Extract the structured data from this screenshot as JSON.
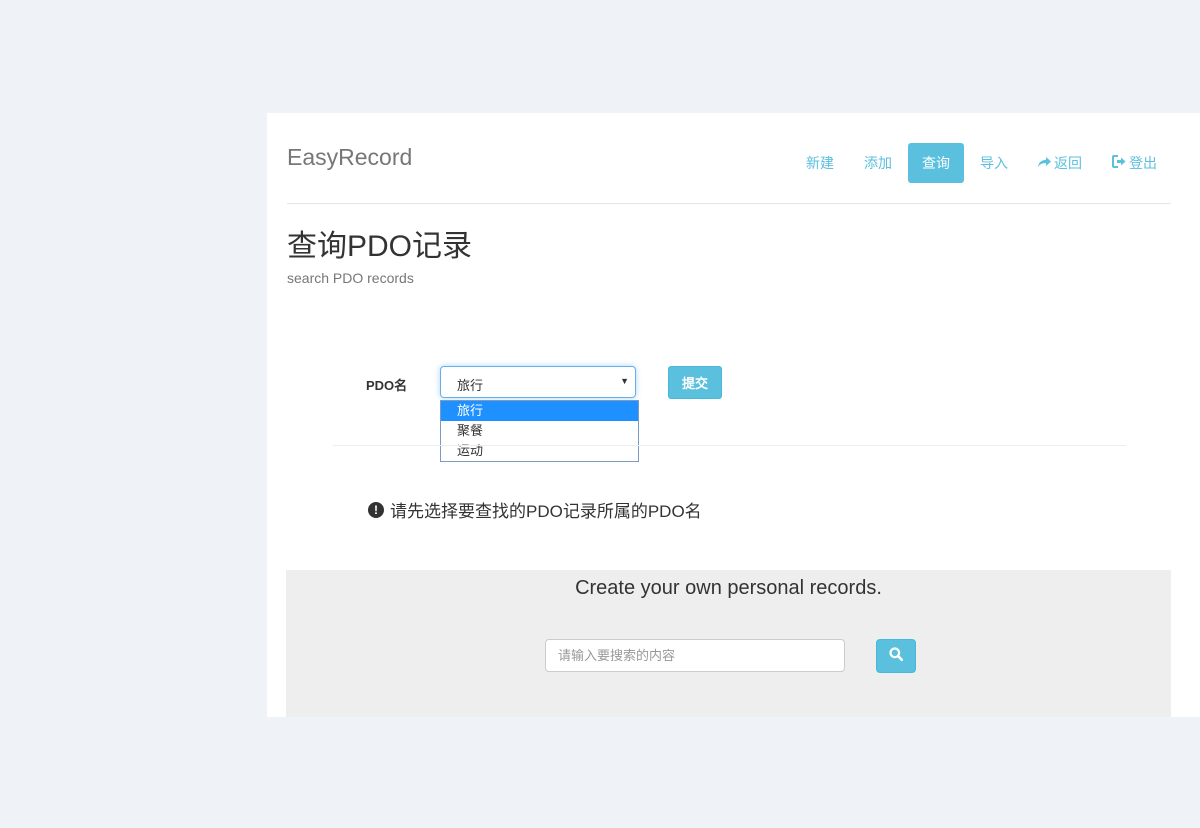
{
  "navbar": {
    "brand": "EasyRecord",
    "items": [
      {
        "label": "新建",
        "icon": null
      },
      {
        "label": "添加",
        "icon": null
      },
      {
        "label": "查询",
        "icon": null,
        "active": true
      },
      {
        "label": "导入",
        "icon": null
      },
      {
        "label": "返回",
        "icon": "share-arrow-icon"
      },
      {
        "label": "登出",
        "icon": "log-out-icon"
      }
    ]
  },
  "header": {
    "title": "查询PDO记录",
    "subtitle": "search PDO records"
  },
  "form": {
    "label": "PDO名",
    "select": {
      "value": "旅行",
      "options": [
        "旅行",
        "聚餐",
        "运动"
      ],
      "highlighted_option": "旅行"
    },
    "submit_label": "提交"
  },
  "hint": {
    "icon": "exclamation-circle-icon",
    "text": "请先选择要查找的PDO记录所属的PDO名"
  },
  "jumbotron": {
    "title": "Create your own personal records.",
    "search_placeholder": "请输入要搜索的内容",
    "search_button_icon": "search-icon"
  },
  "colors": {
    "accent": "#5bc0de",
    "option_highlight": "#1e90ff",
    "background": "#eff2f6",
    "jumbotron_bg": "#eeeeee"
  }
}
